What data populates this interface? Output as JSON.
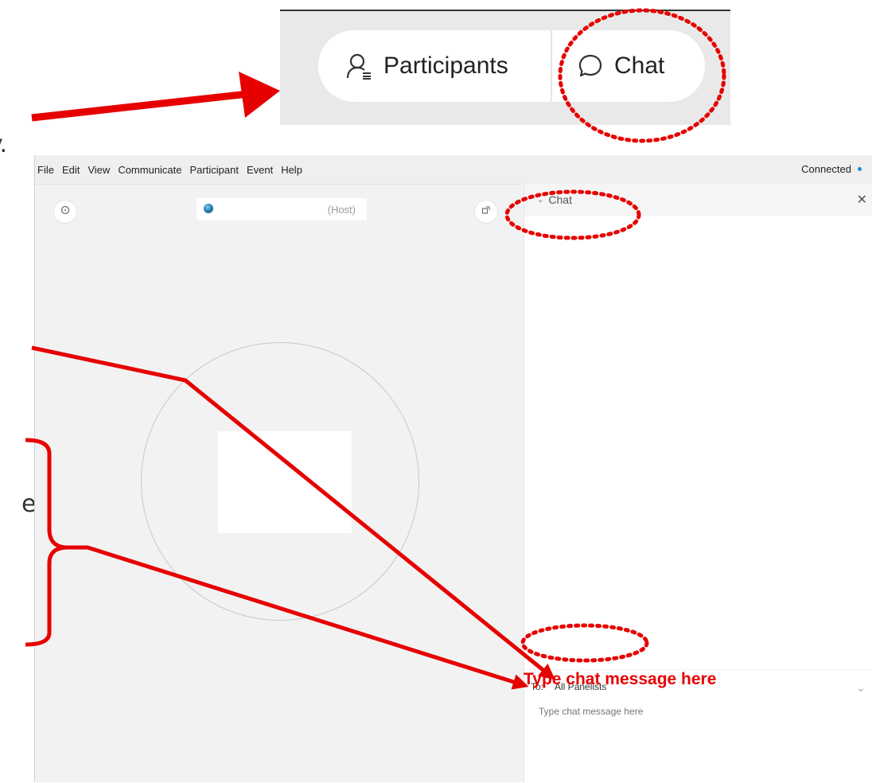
{
  "inset": {
    "participants_label": "Participants",
    "chat_label": "Chat"
  },
  "app": {
    "menu": [
      "File",
      "Edit",
      "View",
      "Communicate",
      "Participant",
      "Event",
      "Help"
    ],
    "status": "Connected",
    "host_label": "(Host)"
  },
  "chat_panel": {
    "title": "Chat",
    "close_glyph": "✕",
    "to_label": "To:",
    "recipient": "All Panelists",
    "message_placeholder": "Type chat message here"
  },
  "annotations": {
    "callout_text": "Type chat message here",
    "cut_off_left_1": "y.",
    "cut_off_left_2": "e",
    "color": "#e60000"
  },
  "icons": {
    "participants": "participants-icon",
    "chat": "chat-bubble-icon",
    "record": "record-icon",
    "popout": "popout-icon",
    "chevron": "chevron-down-icon",
    "close": "close-icon"
  }
}
